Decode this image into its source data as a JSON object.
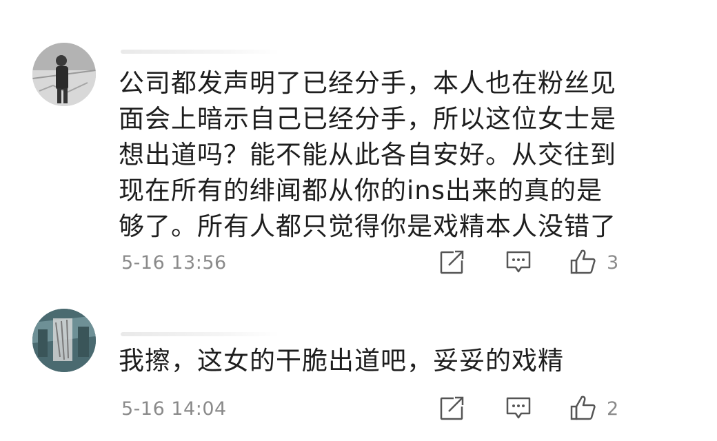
{
  "comments": [
    {
      "avatar_icon": "user-avatar-photo",
      "text": "公司都发声明了已经分手，本人也在粉丝见面会上暗示自己已经分手，所以这位女士是想出道吗？能不能从此各自安好。从交往到现在所有的绯闻都从你的ins出来的真的是够了。所有人都只觉得你是戏精本人没错了",
      "lines": [
        "公司都发声明了已经分手，本人也在粉丝见",
        "面会上暗示自己已经分手，所以这位女士是",
        "想出道吗？能不能从此各自安好。从交往到",
        "现在所有的绯闻都从你的ins出来的真的是",
        "够了。所有人都只觉得你是戏精本人没错了"
      ],
      "time": "5-16 13:56",
      "likes": "3"
    },
    {
      "avatar_icon": "user-avatar-photo",
      "text": "我擦，这女的干脆出道吧，妥妥的戏精",
      "lines": [
        "我擦，这女的干脆出道吧，妥妥的戏精"
      ],
      "time": "5-16 14:04",
      "likes": "2"
    }
  ],
  "icons": {
    "share": "share-icon",
    "reply": "reply-icon",
    "like": "thumbs-up-icon"
  },
  "colors": {
    "text": "#1e1e1e",
    "meta": "#8a8a8a",
    "icon": "#555555"
  }
}
